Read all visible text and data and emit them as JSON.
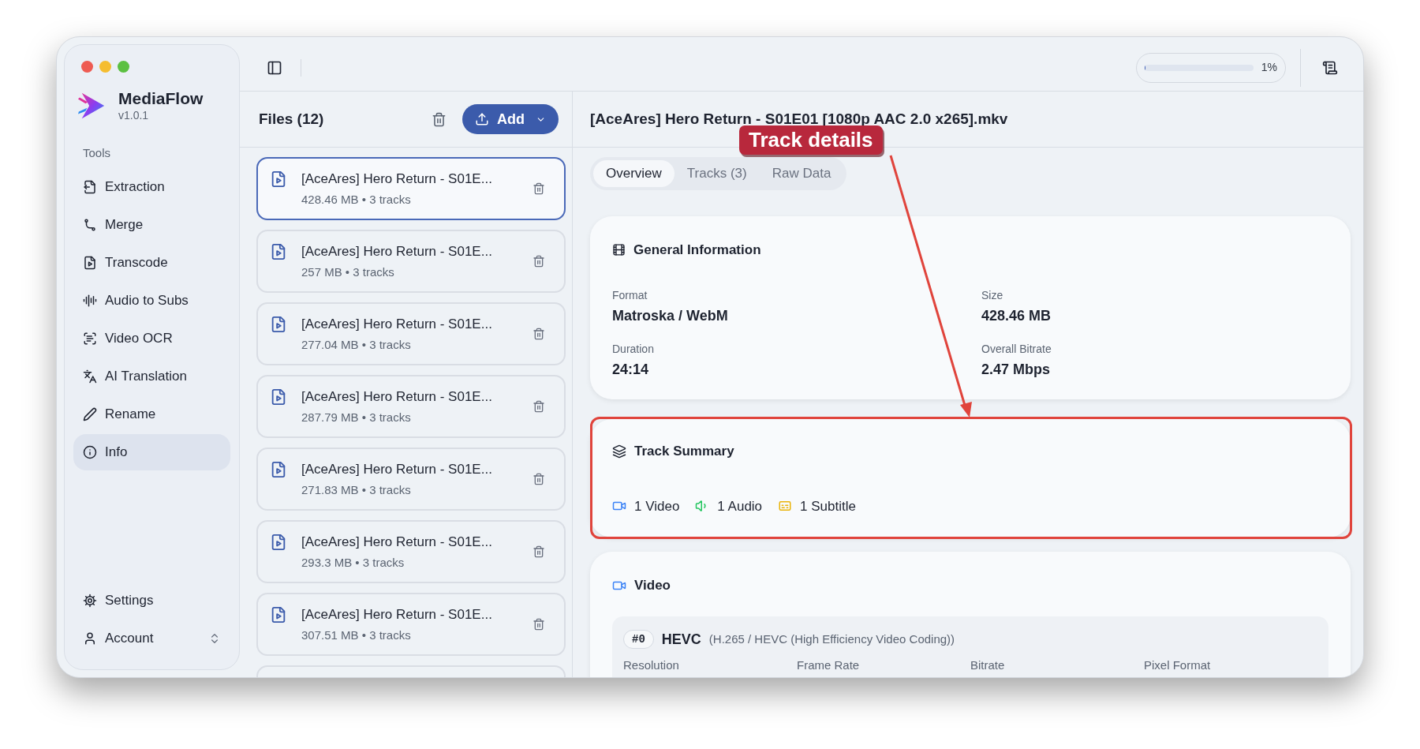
{
  "app": {
    "name": "MediaFlow",
    "version": "v1.0.1"
  },
  "sidebar": {
    "section_label": "Tools",
    "items": [
      {
        "label": "Extraction",
        "kind": "extraction",
        "selected": false
      },
      {
        "label": "Merge",
        "kind": "merge",
        "selected": false
      },
      {
        "label": "Transcode",
        "kind": "transcode",
        "selected": false
      },
      {
        "label": "Audio to Subs",
        "kind": "audio",
        "selected": false
      },
      {
        "label": "Video OCR",
        "kind": "ocr",
        "selected": false
      },
      {
        "label": "AI Translation",
        "kind": "translation",
        "selected": false
      },
      {
        "label": "Rename",
        "kind": "rename",
        "selected": false
      },
      {
        "label": "Info",
        "kind": "info",
        "selected": true
      }
    ],
    "footer_items": [
      {
        "label": "Settings",
        "kind": "settings"
      },
      {
        "label": "Account",
        "kind": "account"
      }
    ]
  },
  "toolbar": {
    "progress": {
      "level": 0.01,
      "reading": "1%"
    }
  },
  "files": {
    "title": "Files (12)",
    "add_button": "Add",
    "more_below": true,
    "items": [
      {
        "name": "[AceAres] Hero Return - S01E...",
        "meta": "428.46 MB • 3 tracks",
        "selected": true
      },
      {
        "name": "[AceAres] Hero Return - S01E...",
        "meta": "257 MB • 3 tracks",
        "selected": false
      },
      {
        "name": "[AceAres] Hero Return - S01E...",
        "meta": "277.04 MB • 3 tracks",
        "selected": false
      },
      {
        "name": "[AceAres] Hero Return - S01E...",
        "meta": "287.79 MB • 3 tracks",
        "selected": false
      },
      {
        "name": "[AceAres] Hero Return - S01E...",
        "meta": "271.83 MB • 3 tracks",
        "selected": false
      },
      {
        "name": "[AceAres] Hero Return - S01E...",
        "meta": "293.3 MB • 3 tracks",
        "selected": false
      },
      {
        "name": "[AceAres] Hero Return - S01E...",
        "meta": "307.51 MB • 3 tracks",
        "selected": false
      }
    ]
  },
  "detail": {
    "title": "[AceAres] Hero Return - S01E01 [1080p AAC 2.0 x265].mkv",
    "tabs": [
      {
        "label": "Overview",
        "selected": true
      },
      {
        "label": "Tracks (3)",
        "selected": false
      },
      {
        "label": "Raw Data",
        "selected": false
      }
    ],
    "general": {
      "title": "General Information",
      "fields": [
        {
          "label": "Format",
          "value": "Matroska / WebM"
        },
        {
          "label": "Size",
          "value": "428.46 MB"
        },
        {
          "label": "Duration",
          "value": "24:14"
        },
        {
          "label": "Overall Bitrate",
          "value": "2.47 Mbps"
        }
      ]
    },
    "track_summary": {
      "title": "Track Summary",
      "counts": [
        {
          "kind": "video",
          "label": "1 Video",
          "color": "#3b82f6"
        },
        {
          "kind": "audio",
          "label": "1 Audio",
          "color": "#22c55e"
        },
        {
          "kind": "subtitle",
          "label": "1 Subtitle",
          "color": "#eab308"
        }
      ]
    },
    "video": {
      "title": "Video",
      "tracks": [
        {
          "index": "#0",
          "codec": "HEVC",
          "description": "(H.265 / HEVC (High Efficiency Video Coding))",
          "field_labels": [
            "Resolution",
            "Frame Rate",
            "Bitrate",
            "Pixel Format"
          ]
        }
      ]
    }
  },
  "annotation": {
    "label": "Track details"
  }
}
